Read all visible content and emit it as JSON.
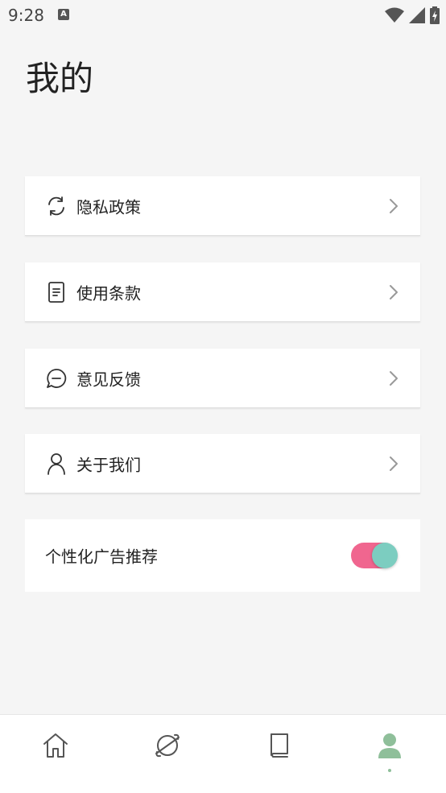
{
  "status_bar": {
    "time": "9:28",
    "notification_icon_label": "A",
    "icons": [
      "wifi-icon",
      "signal-icon",
      "battery-charging-icon"
    ]
  },
  "page": {
    "title": "我的"
  },
  "menu": {
    "items": [
      {
        "label": "隐私政策",
        "icon": "refresh-icon"
      },
      {
        "label": "使用条款",
        "icon": "document-icon"
      },
      {
        "label": "意见反馈",
        "icon": "chat-bubble-icon"
      },
      {
        "label": "关于我们",
        "icon": "person-icon"
      }
    ]
  },
  "ad_setting": {
    "label": "个性化广告推荐",
    "enabled": true
  },
  "bottom_nav": {
    "items": [
      {
        "icon": "home-icon",
        "active": false
      },
      {
        "icon": "planet-icon",
        "active": false
      },
      {
        "icon": "book-icon",
        "active": false
      },
      {
        "icon": "profile-icon",
        "active": true
      }
    ]
  },
  "colors": {
    "background": "#f5f5f5",
    "card": "#ffffff",
    "toggle_track": "#f0668f",
    "toggle_knob": "#7ccdc0",
    "nav_active": "#8fbf9a",
    "nav_inactive": "#555555"
  }
}
